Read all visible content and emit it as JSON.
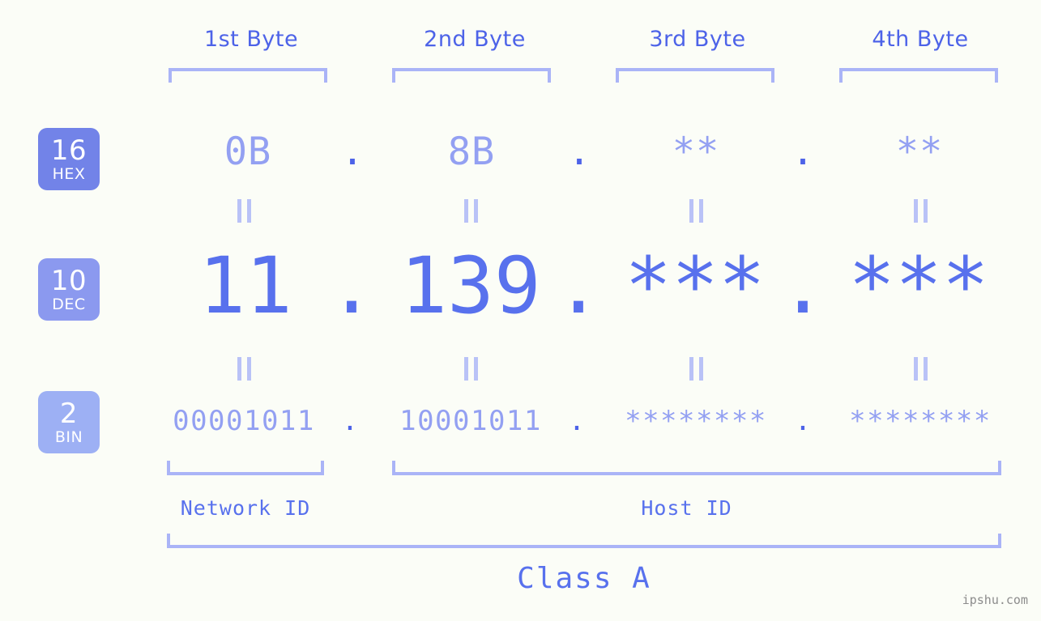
{
  "page": {
    "background_color": "#fbfdf7",
    "accent_color": "#5871ed",
    "muted_accent_color": "#93a0f2",
    "bracket_color": "#aab4f7",
    "watermark": "ipshu.com"
  },
  "headers": [
    {
      "label": "1st Byte"
    },
    {
      "label": "2nd Byte"
    },
    {
      "label": "3rd Byte"
    },
    {
      "label": "4th Byte"
    }
  ],
  "bases": [
    {
      "num": "16",
      "label": "HEX",
      "color": "#7283e8"
    },
    {
      "num": "10",
      "label": "DEC",
      "color": "#8b99ef"
    },
    {
      "num": "2",
      "label": "BIN",
      "color": "#9db0f4"
    }
  ],
  "separator": ".",
  "equals_mark": "=",
  "rows": {
    "hex": {
      "base_num": "16",
      "base_label": "HEX",
      "values": [
        "0B",
        "8B",
        "**",
        "**"
      ]
    },
    "dec": {
      "base_num": "10",
      "base_label": "DEC",
      "values": [
        "11",
        "139",
        "***",
        "***"
      ]
    },
    "bin": {
      "base_num": "2",
      "base_label": "BIN",
      "values": [
        "00001011",
        "10001011",
        "********",
        "********"
      ]
    }
  },
  "groups": {
    "network_id": "Network ID",
    "host_id": "Host ID",
    "class": "Class A"
  }
}
